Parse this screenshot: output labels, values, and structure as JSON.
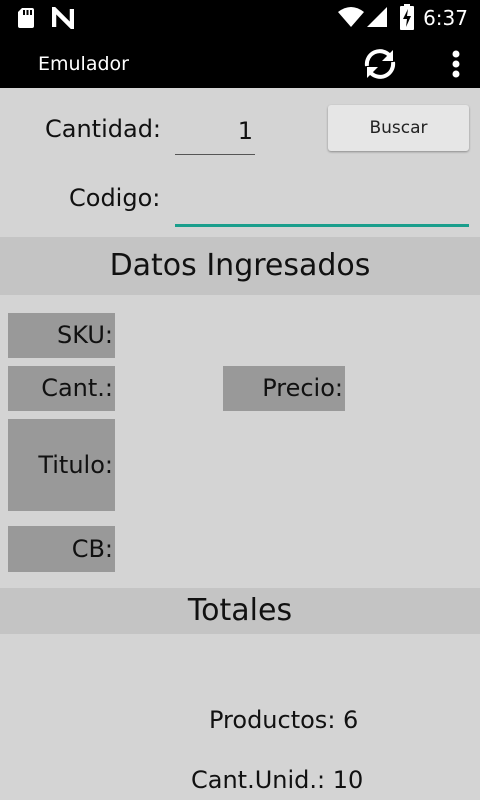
{
  "status_bar": {
    "time": "6:37",
    "icons": [
      "sd-card-icon",
      "n-logo-icon",
      "wifi-icon",
      "signal-icon",
      "battery-charging-icon"
    ]
  },
  "app_bar": {
    "title": "Emulador",
    "icons": [
      "refresh-icon",
      "more-vert-icon"
    ]
  },
  "form": {
    "quantity_label": "Cantidad:",
    "quantity_value": "1",
    "search_button": "Buscar",
    "code_label": "Codigo:",
    "code_value": ""
  },
  "datos": {
    "header": "Datos Ingresados",
    "sku_label": "SKU:",
    "cant_label": "Cant.:",
    "precio_label": "Precio:",
    "titulo_label": "Titulo:",
    "cb_label": "CB:"
  },
  "totales": {
    "header": "Totales",
    "productos": "Productos: 6",
    "cant_unid": "Cant.Unid.: 10"
  },
  "colors": {
    "accent": "#1a9e8c",
    "label_bg": "#999999",
    "section_bg": "#c4c4c4",
    "background": "#d4d4d4"
  }
}
